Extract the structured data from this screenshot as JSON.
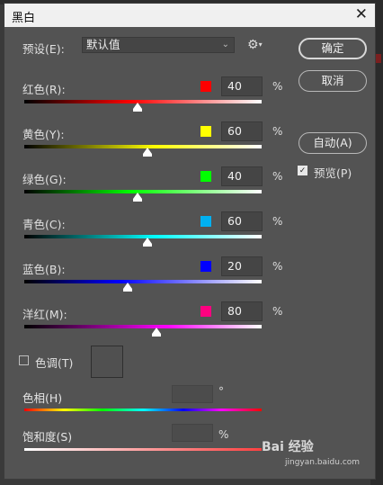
{
  "dialog": {
    "title": "黑白",
    "close_glyph": "✕"
  },
  "preset": {
    "label": "预设(E):",
    "value": "默认值",
    "dropdown_glyph": "⌄"
  },
  "buttons": {
    "ok": "确定",
    "cancel": "取消",
    "auto": "自动(A)"
  },
  "preview": {
    "label": "预览(P)",
    "checked": true
  },
  "channels": [
    {
      "label": "红色(R):",
      "value": "40",
      "unit": "%",
      "color": "#ff0000",
      "position": 0.4
    },
    {
      "label": "黄色(Y):",
      "value": "60",
      "unit": "%",
      "color": "#ffff00",
      "position": 0.54
    },
    {
      "label": "绿色(G):",
      "value": "40",
      "unit": "%",
      "color": "#00ff00",
      "position": 0.4
    },
    {
      "label": "青色(C):",
      "value": "60",
      "unit": "%",
      "color": "#00b0f0",
      "position": 0.54
    },
    {
      "label": "蓝色(B):",
      "value": "20",
      "unit": "%",
      "color": "#0000ff",
      "position": 0.33
    },
    {
      "label": "洋红(M):",
      "value": "80",
      "unit": "%",
      "color": "#ff0080",
      "position": 0.58
    }
  ],
  "tint": {
    "label": "色调(T)",
    "checked": false,
    "hue_label": "色相(H)",
    "hue_unit": "°",
    "saturation_label": "饱和度(S)",
    "saturation_unit": "%"
  },
  "watermark": {
    "brand": "Bai 经验",
    "url": "jingyan.baidu.com"
  }
}
